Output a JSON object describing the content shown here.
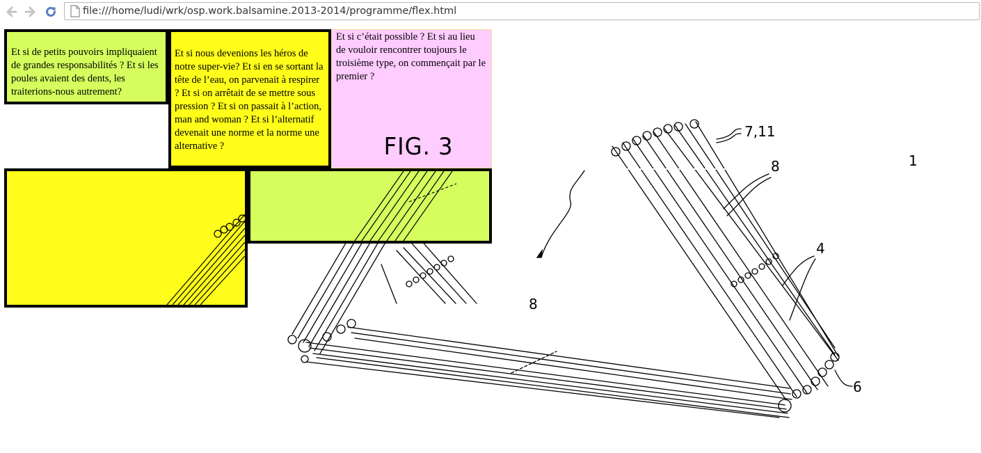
{
  "browser": {
    "url": "file:///home/ludi/wrk/osp.work.balsamine.2013-2014/programme/flex.html"
  },
  "boxes": {
    "box1": "Et si de petits pouvoirs impliquaient de grandes responsabilités ? Et si les poules avaient des dents, les traiterions-nous autrement?",
    "box2": "Et si nous devenions les héros de notre super-vie? Et si en se sortant la tête de l’eau, on parvenait à respirer ? Et si on arrêtait de se mettre sous pression ? Et si on passait à l’action, man and woman ? Et si l’alternatif devenait une norme et la norme une alternative ?",
    "box3": "Et si c’était possible ? Et si au lieu de vouloir rencontrer toujours le troisième type, on commençait par le premier ?"
  },
  "figure": {
    "caption": "FIG. 3",
    "labels": [
      "7,11",
      "1",
      "4",
      "6",
      "8",
      "8"
    ]
  },
  "colors": {
    "yellow": "#fffd19",
    "lime": "#d4fd5d",
    "pink": "#ffccff",
    "border": "#000000"
  }
}
